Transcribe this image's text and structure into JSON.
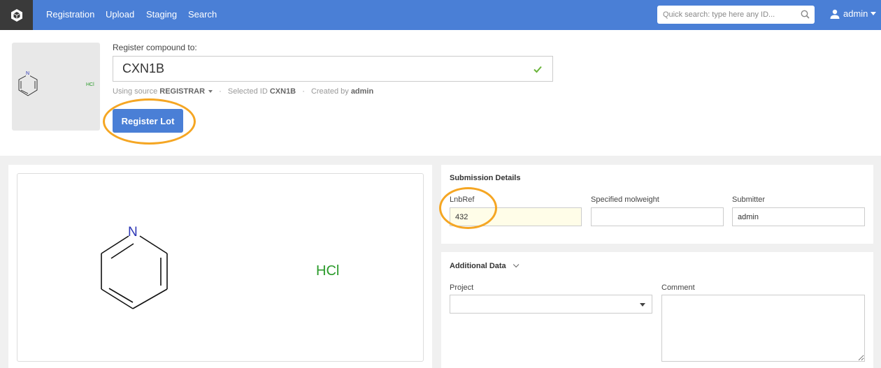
{
  "nav": {
    "items": [
      "Registration",
      "Upload",
      "Staging",
      "Search"
    ],
    "search_placeholder": "Quick search: type here any ID...",
    "user": "admin"
  },
  "header": {
    "label": "Register compound to:",
    "compound_id": "CXN1B",
    "source_prefix": "Using source",
    "source": "REGISTRAR",
    "selected_prefix": "Selected ID",
    "selected_id": "CXN1B",
    "created_prefix": "Created by",
    "created_by": "admin",
    "button": "Register Lot"
  },
  "structure": {
    "atom_label": "N",
    "salt": "HCl"
  },
  "submission": {
    "title": "Submission Details",
    "lnbref_label": "LnbRef",
    "lnbref_value": "432",
    "molweight_label": "Specified molweight",
    "molweight_value": "",
    "submitter_label": "Submitter",
    "submitter_value": "admin"
  },
  "additional": {
    "title": "Additional Data",
    "project_label": "Project",
    "project_value": "",
    "comment_label": "Comment"
  },
  "colors": {
    "nav": "#4a7fd6",
    "highlight": "#f5a623",
    "salt": "#2a9a2a",
    "nitrogen": "#2b35b5"
  },
  "icons": [
    "logo-icon",
    "search-icon",
    "user-icon",
    "caret-down-icon",
    "check-icon"
  ]
}
